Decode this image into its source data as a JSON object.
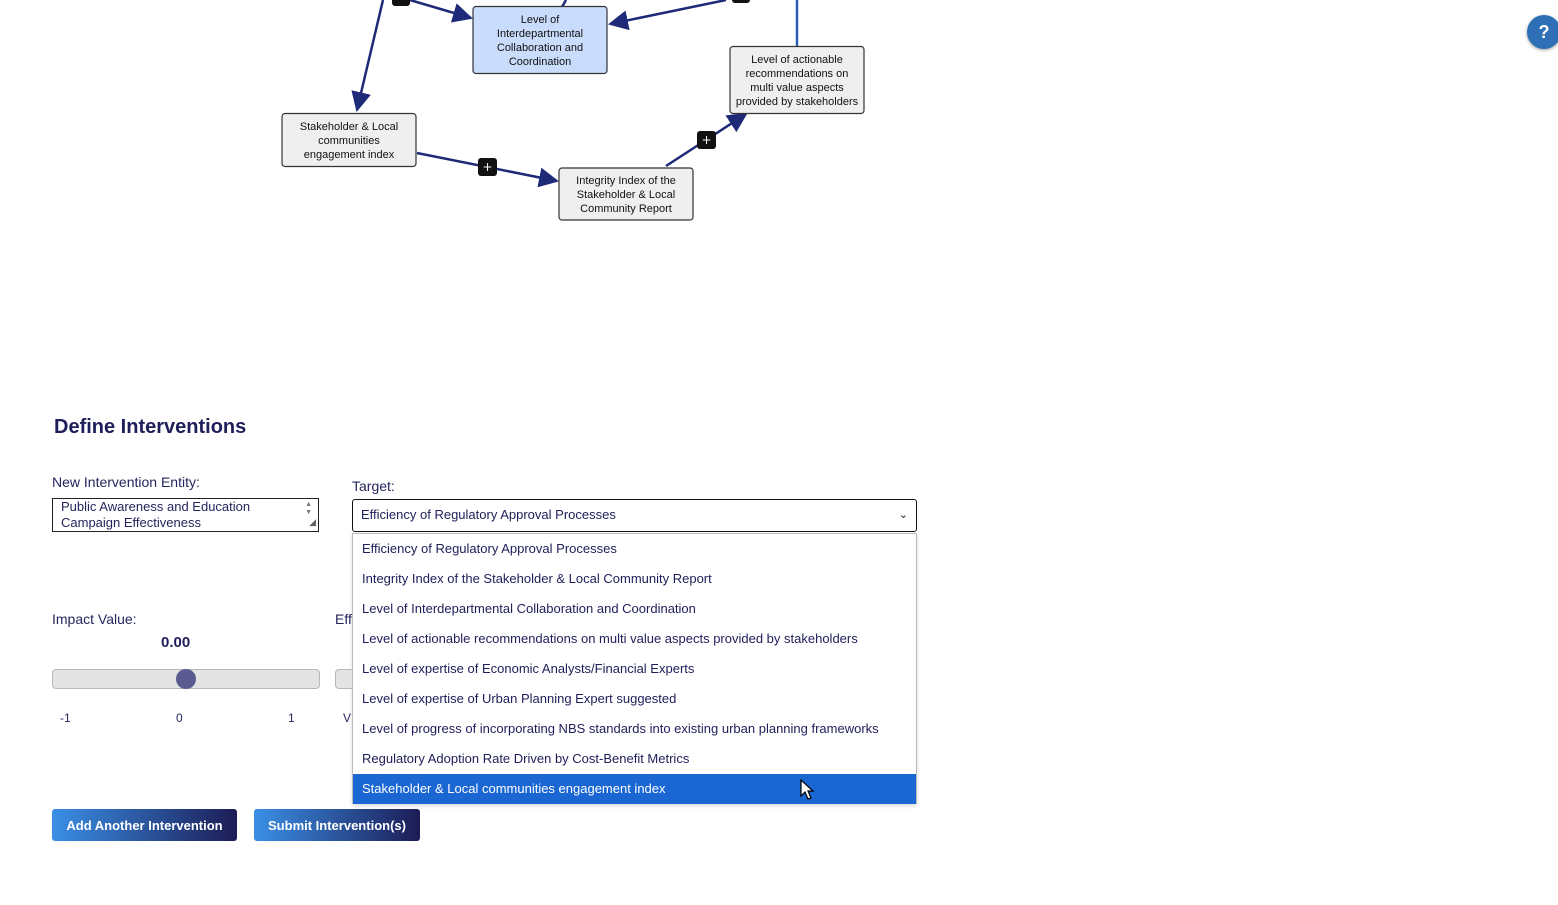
{
  "graph": {
    "nodes": [
      {
        "id": "collab",
        "label": "Level of Interdepartmental Collaboration and Coordination",
        "lines": [
          "Level of",
          "Interdepartmental",
          "Collaboration and",
          "Coordination"
        ],
        "selected": true
      },
      {
        "id": "actionable",
        "label": "Level of actionable recommendations on multi value aspects provided by stakeholders",
        "lines": [
          "Level of actionable",
          "recommendations on",
          "multi value aspects",
          "provided by stakeholders"
        ],
        "selected": false
      },
      {
        "id": "stakeholder",
        "label": "Stakeholder & Local communities engagement index",
        "lines": [
          "Stakeholder & Local",
          "communities",
          "engagement index"
        ],
        "selected": false
      },
      {
        "id": "integrity",
        "label": "Integrity Index of the Stakeholder & Local Community Report",
        "lines": [
          "Integrity Index of the",
          "Stakeholder & Local",
          "Community Report"
        ],
        "selected": false
      }
    ],
    "edge_signs": [
      "+",
      "+"
    ],
    "colors": {
      "edge": "#1e2a78",
      "node_selected": "#c9dcfb",
      "node": "#efefef",
      "sign_bg": "#111111"
    }
  },
  "help": {
    "icon": "help-icon",
    "label": "?"
  },
  "form": {
    "title": "Define Interventions",
    "entity_label": "New Intervention Entity:",
    "entity_value": "Public Awareness and Education Campaign Effectiveness",
    "target_label": "Target:",
    "target_selected": "Efficiency of Regulatory Approval Processes",
    "target_options": [
      "Efficiency of Regulatory Approval Processes",
      "Integrity Index of the Stakeholder & Local Community Report",
      "Level of Interdepartmental Collaboration and Coordination",
      "Level of actionable recommendations on multi value aspects provided by stakeholders",
      "Level of expertise of Economic Analysts/Financial Experts",
      "Level of expertise of Urban Planning Expert suggested",
      "Level of progress of incorporating NBS standards into existing urban planning frameworks",
      "Regulatory Adoption Rate Driven by Cost-Benefit Metrics",
      "Stakeholder & Local communities engagement index"
    ],
    "highlighted_option_index": 8,
    "impact_label": "Impact Value:",
    "impact_value": "0.00",
    "impact_value_num": 0,
    "impact_range": [
      -1,
      1
    ],
    "impact_ticks": [
      "-1",
      "0",
      "1"
    ],
    "partial_label_top": "Eff",
    "partial_label_bottom": "V",
    "add_button": "Add Another Intervention",
    "submit_button": "Submit Intervention(s)"
  },
  "colors": {
    "accent": "#1a66d2",
    "text": "#1e1e5a"
  }
}
